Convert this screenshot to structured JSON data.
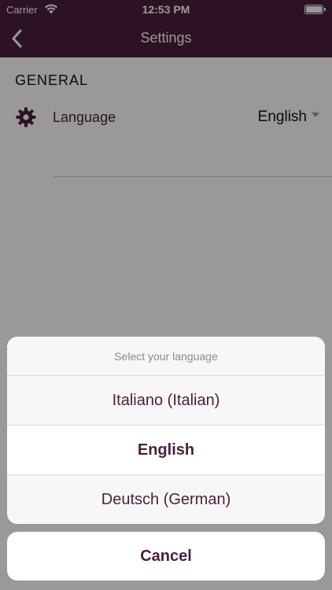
{
  "status_bar": {
    "carrier": "Carrier",
    "time": "12:53 PM"
  },
  "nav": {
    "title": "Settings",
    "back_icon": "chevron-left-icon"
  },
  "settings": {
    "section_title": "GENERAL",
    "rows": [
      {
        "icon": "gear-icon",
        "label": "Language",
        "value": "English"
      }
    ]
  },
  "language_sheet": {
    "title": "Select your language",
    "options": [
      {
        "label": "Italiano (Italian)",
        "selected": false
      },
      {
        "label": "English",
        "selected": true
      },
      {
        "label": "Deutsch (German)",
        "selected": false
      }
    ],
    "cancel_label": "Cancel"
  },
  "colors": {
    "brand": "#4a1f3d",
    "sheet_background": "#f7f7f7",
    "overlay": "rgba(0,0,0,0.4)"
  }
}
